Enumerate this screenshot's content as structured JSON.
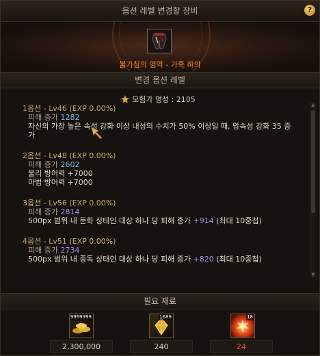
{
  "window": {
    "title": "옵션 레벨 변경할 장비",
    "help_label": "?"
  },
  "item": {
    "name": "불가침의 영역 - 가죽 하의",
    "icon": "leather-pants-icon"
  },
  "section_titles": {
    "options": "변경 옵션 레벨",
    "materials": "필요 재료"
  },
  "fame": {
    "label": "모험가 명성 : 2105",
    "icon": "fame-star-icon"
  },
  "options": [
    {
      "header": "1옵션 - Lv46 (EXP 0.00%)",
      "dmg_label": "피해 증가",
      "dmg_value": "1282",
      "desc_line1": "자신의 가장 높은 속성 강화 이상 내성의 수치가 50% 이상일 때, 암속성 강화 35 증",
      "desc_line2": "가"
    },
    {
      "header": "2옵션 - Lv48 (EXP 0.00%)",
      "dmg_label": "피해 증가",
      "dmg_value": "2602",
      "line1": "물리 방어력 +7000",
      "line2": "마법 방어력 +7000"
    },
    {
      "header": "3옵션 - Lv56 (EXP 0.00%)",
      "dmg_label": "피해 증가",
      "dmg_value": "2814",
      "desc_pre": "500px 범위 내 둔화 상태인 대상 하나 당 피해 증가 ",
      "desc_value": "+914",
      "desc_post": " (최대 10중첩)"
    },
    {
      "header": "4옵션 - Lv51 (EXP 0.00%)",
      "dmg_label": "피해 증가",
      "dmg_value": "2734",
      "desc_pre": "500px 범위 내 중독 상태인 대상 하나 당 피해 증가 ",
      "desc_value": "+820",
      "desc_post": " (최대 10중첩)"
    }
  ],
  "materials": [
    {
      "icon": "gold-coins-icon",
      "badge": "9999999",
      "quantity": "2,300,000",
      "quantity_color": "#d8cfbf"
    },
    {
      "icon": "crystal-shard-icon",
      "badge": "1689",
      "quantity": "240",
      "quantity_color": "#d8cfbf"
    },
    {
      "icon": "burning-orb-icon",
      "badge": "18",
      "quantity": "24",
      "quantity_color": "#ff3a2a"
    }
  ],
  "colors": {
    "accent": "#ff8a2a",
    "option_header": "#c6a86c",
    "blue_value": "#7fb7e8",
    "purple_value": "#a58bf0"
  }
}
